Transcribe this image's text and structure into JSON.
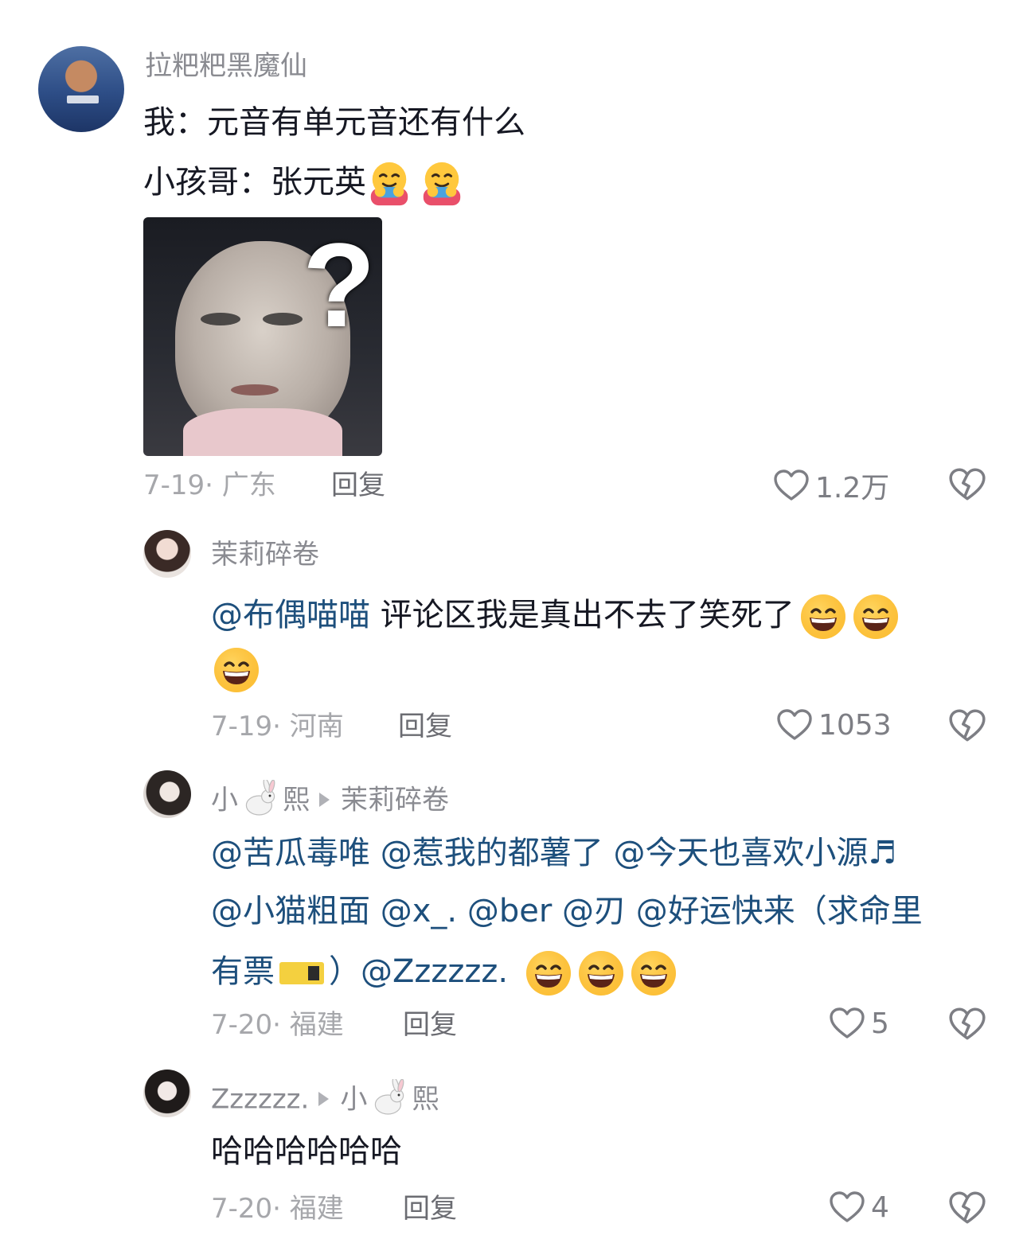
{
  "comments": [
    {
      "username": "拉粑粑黑魔仙",
      "lines": [
        "我：元音有单元音还有什么",
        "小孩哥：张元英"
      ],
      "image_overlay": "?",
      "date": "7-19",
      "location": "广东",
      "reply_label": "回复",
      "likes": "1.2万"
    },
    {
      "username": "茉莉碎卷",
      "mention": "@布偶喵喵",
      "text": "评论区我是真出不去了笑死了",
      "date": "7-19",
      "location": "河南",
      "reply_label": "回复",
      "likes": "1053"
    },
    {
      "username_pre": "小",
      "username_post": "熙",
      "reply_to": "茉莉碎卷",
      "line1": [
        "@苦瓜毒唯",
        "@惹我的都薯了",
        "@今天也喜欢小源♬"
      ],
      "line2": [
        "@小猫粗面",
        "@x_.",
        "@ber",
        "@刃",
        "@好运快来（求命里"
      ],
      "line3_pre": "有票",
      "line3_post": "）@Zzzzzz.",
      "date": "7-20",
      "location": "福建",
      "reply_label": "回复",
      "likes": "5"
    },
    {
      "username": "Zzzzzz.",
      "reply_to_pre": "小",
      "reply_to_post": "熙",
      "text": "哈哈哈哈哈哈",
      "date": "7-20",
      "location": "福建",
      "reply_label": "回复",
      "likes": "4"
    }
  ],
  "icons": {
    "like": "heart-outline-icon",
    "dislike": "broken-heart-icon",
    "emoji_hug": "hugging-face-emoji",
    "emoji_grin": "grinning-face-emoji",
    "emoji_rabbit": "rabbit-emoji"
  },
  "colors": {
    "mention": "#1d4f7c",
    "meta": "#a6a7ab"
  }
}
